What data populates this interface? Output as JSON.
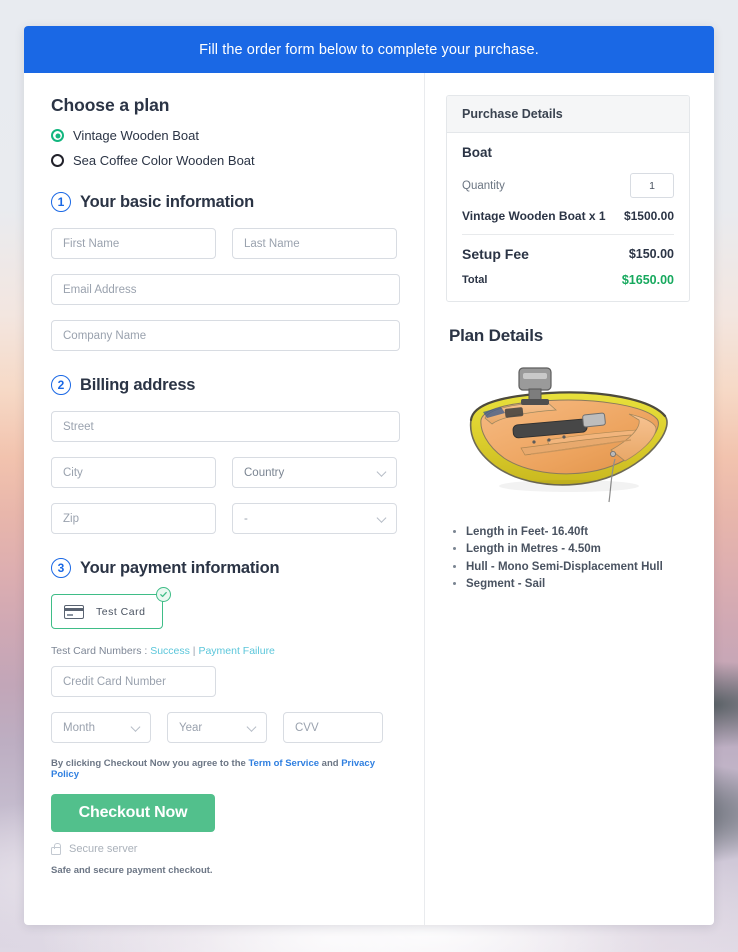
{
  "banner": {
    "text": "Fill the order form below to complete your purchase."
  },
  "plan": {
    "heading": "Choose a plan",
    "options": [
      {
        "label": "Vintage Wooden Boat",
        "selected": true
      },
      {
        "label": "Sea Coffee Color Wooden Boat",
        "selected": false
      }
    ]
  },
  "steps": {
    "basic": {
      "number": "1",
      "title": "Your basic information"
    },
    "billing": {
      "number": "2",
      "title": "Billing address"
    },
    "payment": {
      "number": "3",
      "title": "Your payment information"
    }
  },
  "basic_fields": {
    "first_name": {
      "placeholder": "First Name",
      "value": ""
    },
    "last_name": {
      "placeholder": "Last Name",
      "value": ""
    },
    "email": {
      "placeholder": "Email Address",
      "value": ""
    },
    "company": {
      "placeholder": "Company Name",
      "value": ""
    }
  },
  "billing_fields": {
    "street": {
      "placeholder": "Street",
      "value": ""
    },
    "city": {
      "placeholder": "City",
      "value": ""
    },
    "country": {
      "placeholder": "Country",
      "value": "Country"
    },
    "zip": {
      "placeholder": "Zip",
      "value": ""
    },
    "state": {
      "placeholder": "-",
      "value": "-"
    }
  },
  "payment": {
    "method_label": "Test  Card",
    "method_icon": "credit-card-icon",
    "method_selected": true,
    "test_cards_prefix": "Test Card Numbers : ",
    "link_success": "Success",
    "separator": " | ",
    "link_failure": "Payment Failure",
    "card_number": {
      "placeholder": "Credit Card Number",
      "value": ""
    },
    "month": {
      "placeholder": "Month",
      "value": "Month"
    },
    "year": {
      "placeholder": "Year",
      "value": "Year"
    },
    "cvv": {
      "placeholder": "CVV",
      "value": ""
    }
  },
  "terms": {
    "prefix": "By clicking Checkout Now you agree to the ",
    "tos": "Term of Service",
    "and": " and ",
    "privacy": "Privacy Policy"
  },
  "checkout": {
    "button_label": "Checkout Now",
    "secure_label": "Secure server",
    "safe_note": "Safe and secure payment checkout."
  },
  "purchase_details": {
    "panel_title": "Purchase Details",
    "item_group": "Boat",
    "quantity_label": "Quantity",
    "quantity_value": "1",
    "line_item_label": "Vintage Wooden Boat x 1",
    "line_item_price": "$1500.00",
    "setup_fee_label": "Setup Fee",
    "setup_fee_price": "$150.00",
    "total_label": "Total",
    "total_price": "$1650.00"
  },
  "plan_details": {
    "title": "Plan Details",
    "image_alt": "vintage-wooden-boat-photo",
    "specs": [
      "Length in Feet- 16.40ft",
      "Length in Metres - 4.50m",
      "Hull - Mono Semi-Displacement Hull",
      "Segment - Sail"
    ]
  },
  "colors": {
    "banner_blue": "#1a68e5",
    "accent_green": "#52c08c",
    "total_green": "#17a95e",
    "link_blue": "#2f7fe0",
    "link_cyan": "#5bc6da"
  }
}
